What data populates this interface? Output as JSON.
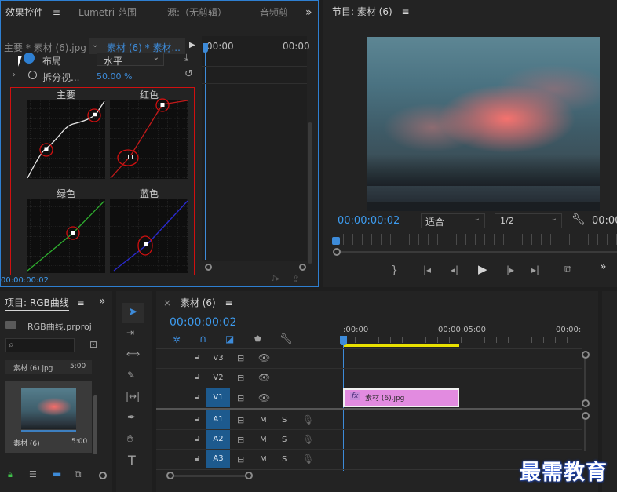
{
  "effect_controls": {
    "tabs": [
      "效果控件",
      "Lumetri 范围",
      "源:（无剪辑）",
      "音频剪"
    ],
    "menu_glyph": "≡",
    "overflow": "»",
    "clip_master": "主要 * 素材 (6).jpg",
    "clip_current": "素材 (6) * 素材...",
    "ruler_left": "00:00",
    "ruler_right": "00:00",
    "layout_label": "布局",
    "layout_value": "水平",
    "split_label": "拆分视...",
    "split_value": "50.00 %",
    "curves": [
      "主要",
      "红色",
      "绿色",
      "蓝色"
    ],
    "timecode": "00:00:00:02"
  },
  "program_monitor": {
    "title": "节目: 素材 (6)",
    "menu_glyph": "≡",
    "timecode": "00:00:00:02",
    "fit_value": "适合",
    "quality_value": "1/2",
    "duration": "00:00"
  },
  "project": {
    "title": "项目: RGB曲线",
    "menu_glyph": "≡",
    "file_name": "RGB曲线.prproj",
    "search_placeholder": "",
    "item_name": "素材 (6).jpg",
    "item_duration": "5:00",
    "thumb_name": "素材 (6)",
    "thumb_duration": "5:00"
  },
  "timeline": {
    "tab_close": "×",
    "title": "素材 (6)",
    "menu_glyph": "≡",
    "timecode": "00:00:00:02",
    "ruler": [
      ":00:00",
      "00:00:05:00",
      "00:00:"
    ],
    "video_tracks": [
      "V3",
      "V2",
      "V1"
    ],
    "audio_tracks": [
      "A1",
      "A2",
      "A3"
    ],
    "mute": "M",
    "solo": "S",
    "clip_label": "素材 (6).jpg",
    "clip_fx": "fx"
  },
  "watermark": "最需教育",
  "colors": {
    "accent": "#3d9cf0",
    "clip": "#e28be0",
    "highlight_box": "#d01010",
    "timeline_bar": "#e8e000"
  }
}
